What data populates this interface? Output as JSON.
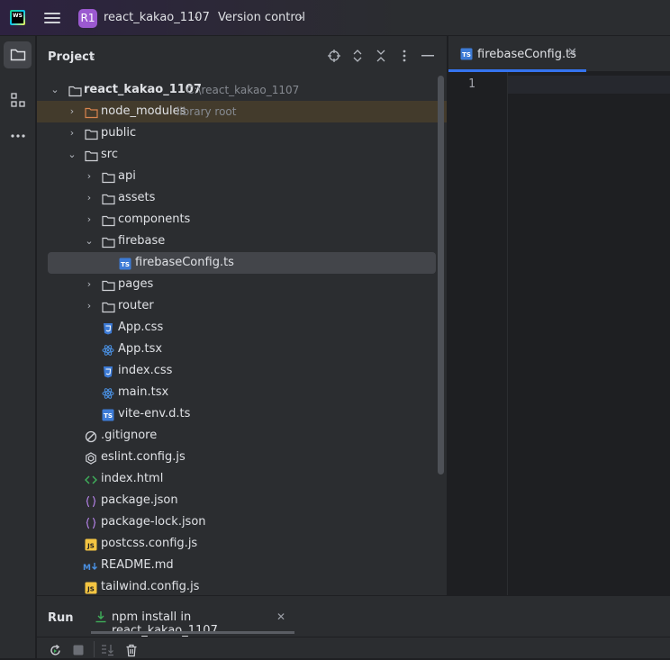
{
  "titlebar": {
    "logo_text": "WS",
    "project_badge": "R1",
    "project_name": "react_kakao_1107",
    "version_control": "Version control"
  },
  "panel": {
    "title": "Project"
  },
  "tree": [
    {
      "label": "react_kakao_1107",
      "hint": "C:\\react_kakao_1107",
      "bold": true
    },
    {
      "label": "node_modules",
      "hint": "library root"
    },
    {
      "label": "public"
    },
    {
      "label": "src"
    },
    {
      "label": "api"
    },
    {
      "label": "assets"
    },
    {
      "label": "components"
    },
    {
      "label": "firebase"
    },
    {
      "label": "firebaseConfig.ts"
    },
    {
      "label": "pages"
    },
    {
      "label": "router"
    },
    {
      "label": "App.css"
    },
    {
      "label": "App.tsx"
    },
    {
      "label": "index.css"
    },
    {
      "label": "main.tsx"
    },
    {
      "label": "vite-env.d.ts"
    },
    {
      "label": ".gitignore"
    },
    {
      "label": "eslint.config.js"
    },
    {
      "label": "index.html"
    },
    {
      "label": "package.json"
    },
    {
      "label": "package-lock.json"
    },
    {
      "label": "postcss.config.js"
    },
    {
      "label": "README.md"
    },
    {
      "label": "tailwind.config.js"
    }
  ],
  "editor": {
    "tab_label": "firebaseConfig.ts",
    "tab_icon_text": "TS",
    "line_number": "1"
  },
  "run": {
    "title": "Run",
    "tab_label": "npm install in react_kakao_1107"
  },
  "colors": {
    "accent": "#3574f0",
    "ts_icon": "#3d7bd6",
    "css_icon": "#3d7bd6",
    "react_icon": "#4a90e2",
    "js_icon": "#f4c542",
    "json_icon": "#a97bd8",
    "html_icon": "#3fae5a",
    "badge": "#9b59d0"
  }
}
